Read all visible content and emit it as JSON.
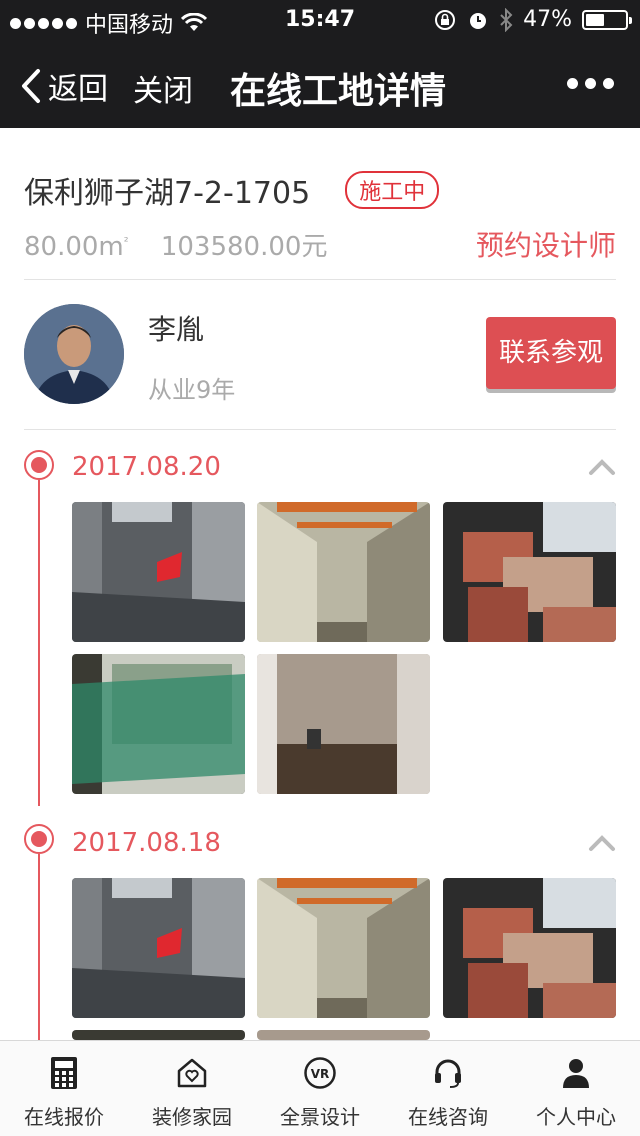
{
  "status_bar": {
    "carrier": "中国移动",
    "time": "15:47",
    "battery": "47%",
    "battery_level": 0.47
  },
  "nav": {
    "back": "返回",
    "close": "关闭",
    "title": "在线工地详情"
  },
  "project": {
    "name": "保利狮子湖7-2-1705",
    "status": "施工中",
    "area": "80.00m",
    "area_unit_sup": "²",
    "price": "103580.00元",
    "book_designer": "预约设计师"
  },
  "designer": {
    "name": "李胤",
    "experience": "从业9年",
    "contact_button": "联系参观"
  },
  "timeline": [
    {
      "date": "2017.08.20",
      "photo_count": 5
    },
    {
      "date": "2017.08.18",
      "photo_count": 5
    }
  ],
  "tabbar": [
    {
      "label": "在线报价",
      "icon": "calculator-icon"
    },
    {
      "label": "装修家园",
      "icon": "home-heart-icon"
    },
    {
      "label": "全景设计",
      "icon": "vr-icon"
    },
    {
      "label": "在线咨询",
      "icon": "headset-icon"
    },
    {
      "label": "个人中心",
      "icon": "person-icon"
    }
  ]
}
